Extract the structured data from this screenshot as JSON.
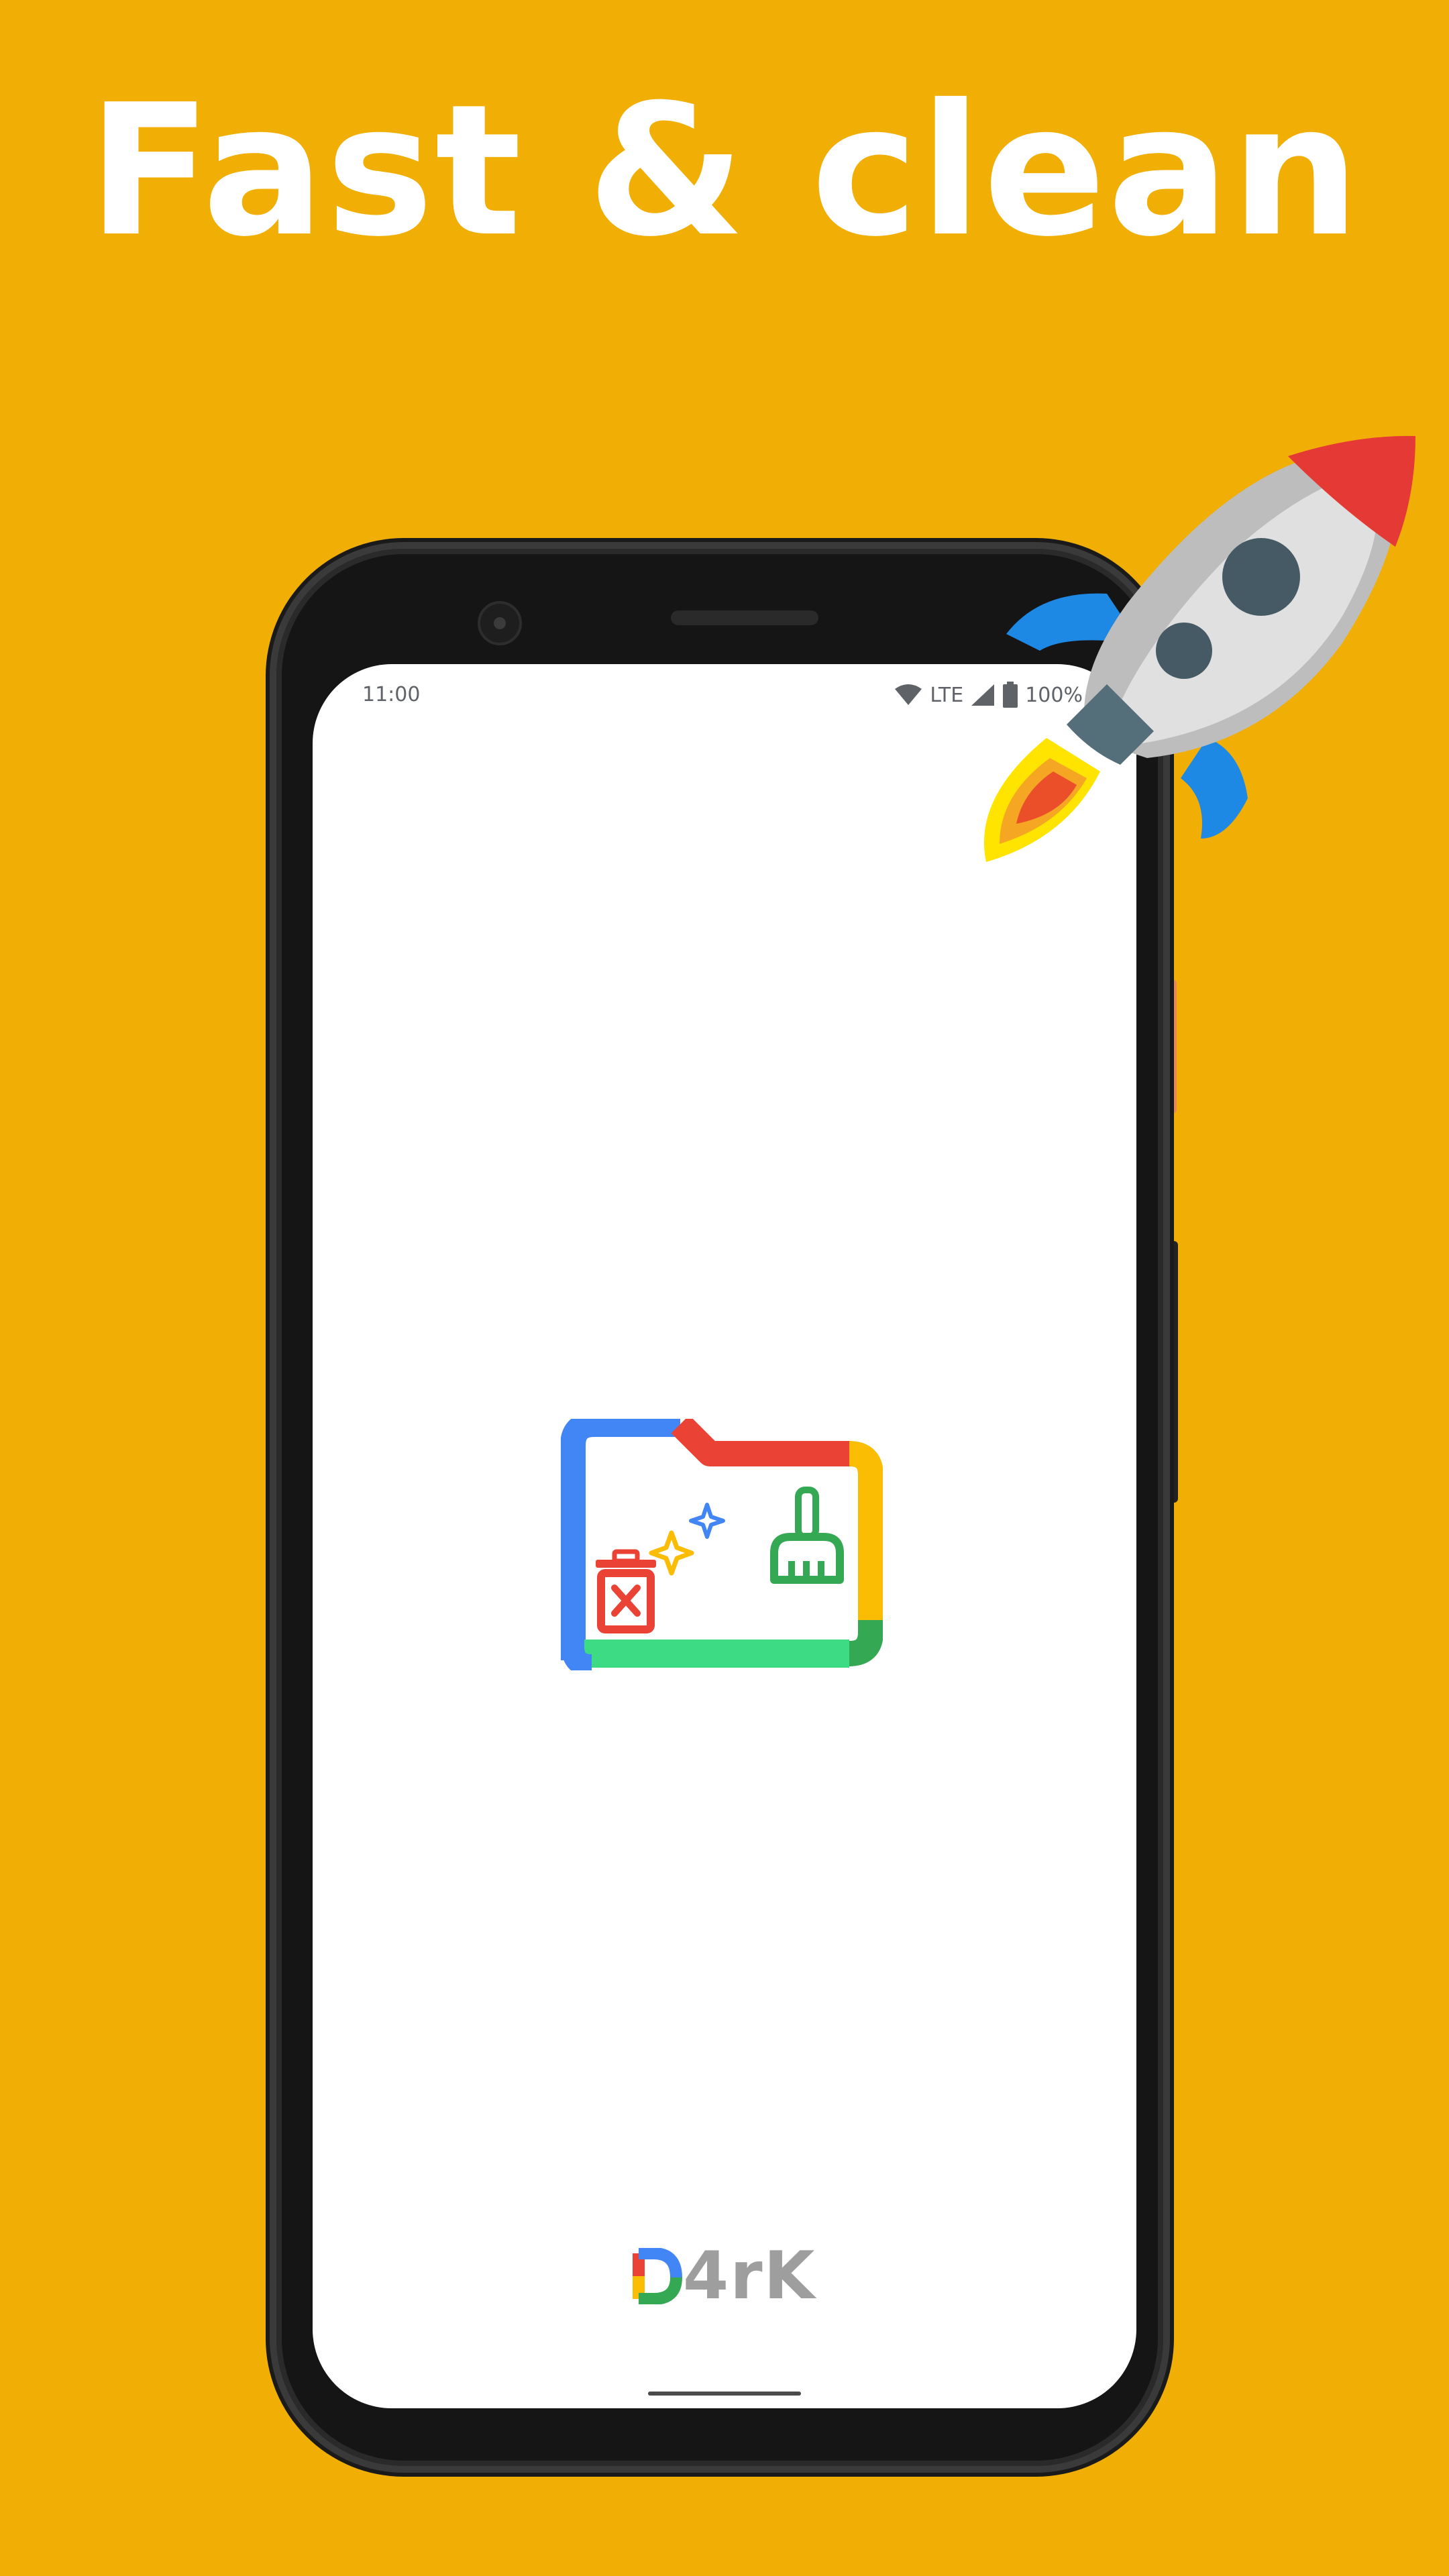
{
  "headline": "Fast & clean",
  "status_bar": {
    "time": "11:00",
    "network": "LTE",
    "battery": "100%"
  },
  "brand": {
    "label": "4rK",
    "letter_colors": [
      "#EA4335",
      "#FBBC04",
      "#34A853",
      "#4285F4"
    ]
  },
  "colors": {
    "background": "#F1AE04",
    "headline": "#FFFFFF",
    "screen": "#FFFFFF",
    "logo_blue": "#4285F4",
    "logo_red": "#EA4335",
    "logo_yellow": "#FBBC04",
    "logo_green": "#34A853"
  },
  "icons": [
    "app-logo-icon",
    "rocket-icon",
    "wifi-icon",
    "signal-icon",
    "battery-icon",
    "trash-icon",
    "broom-icon",
    "sparkle-icon"
  ]
}
